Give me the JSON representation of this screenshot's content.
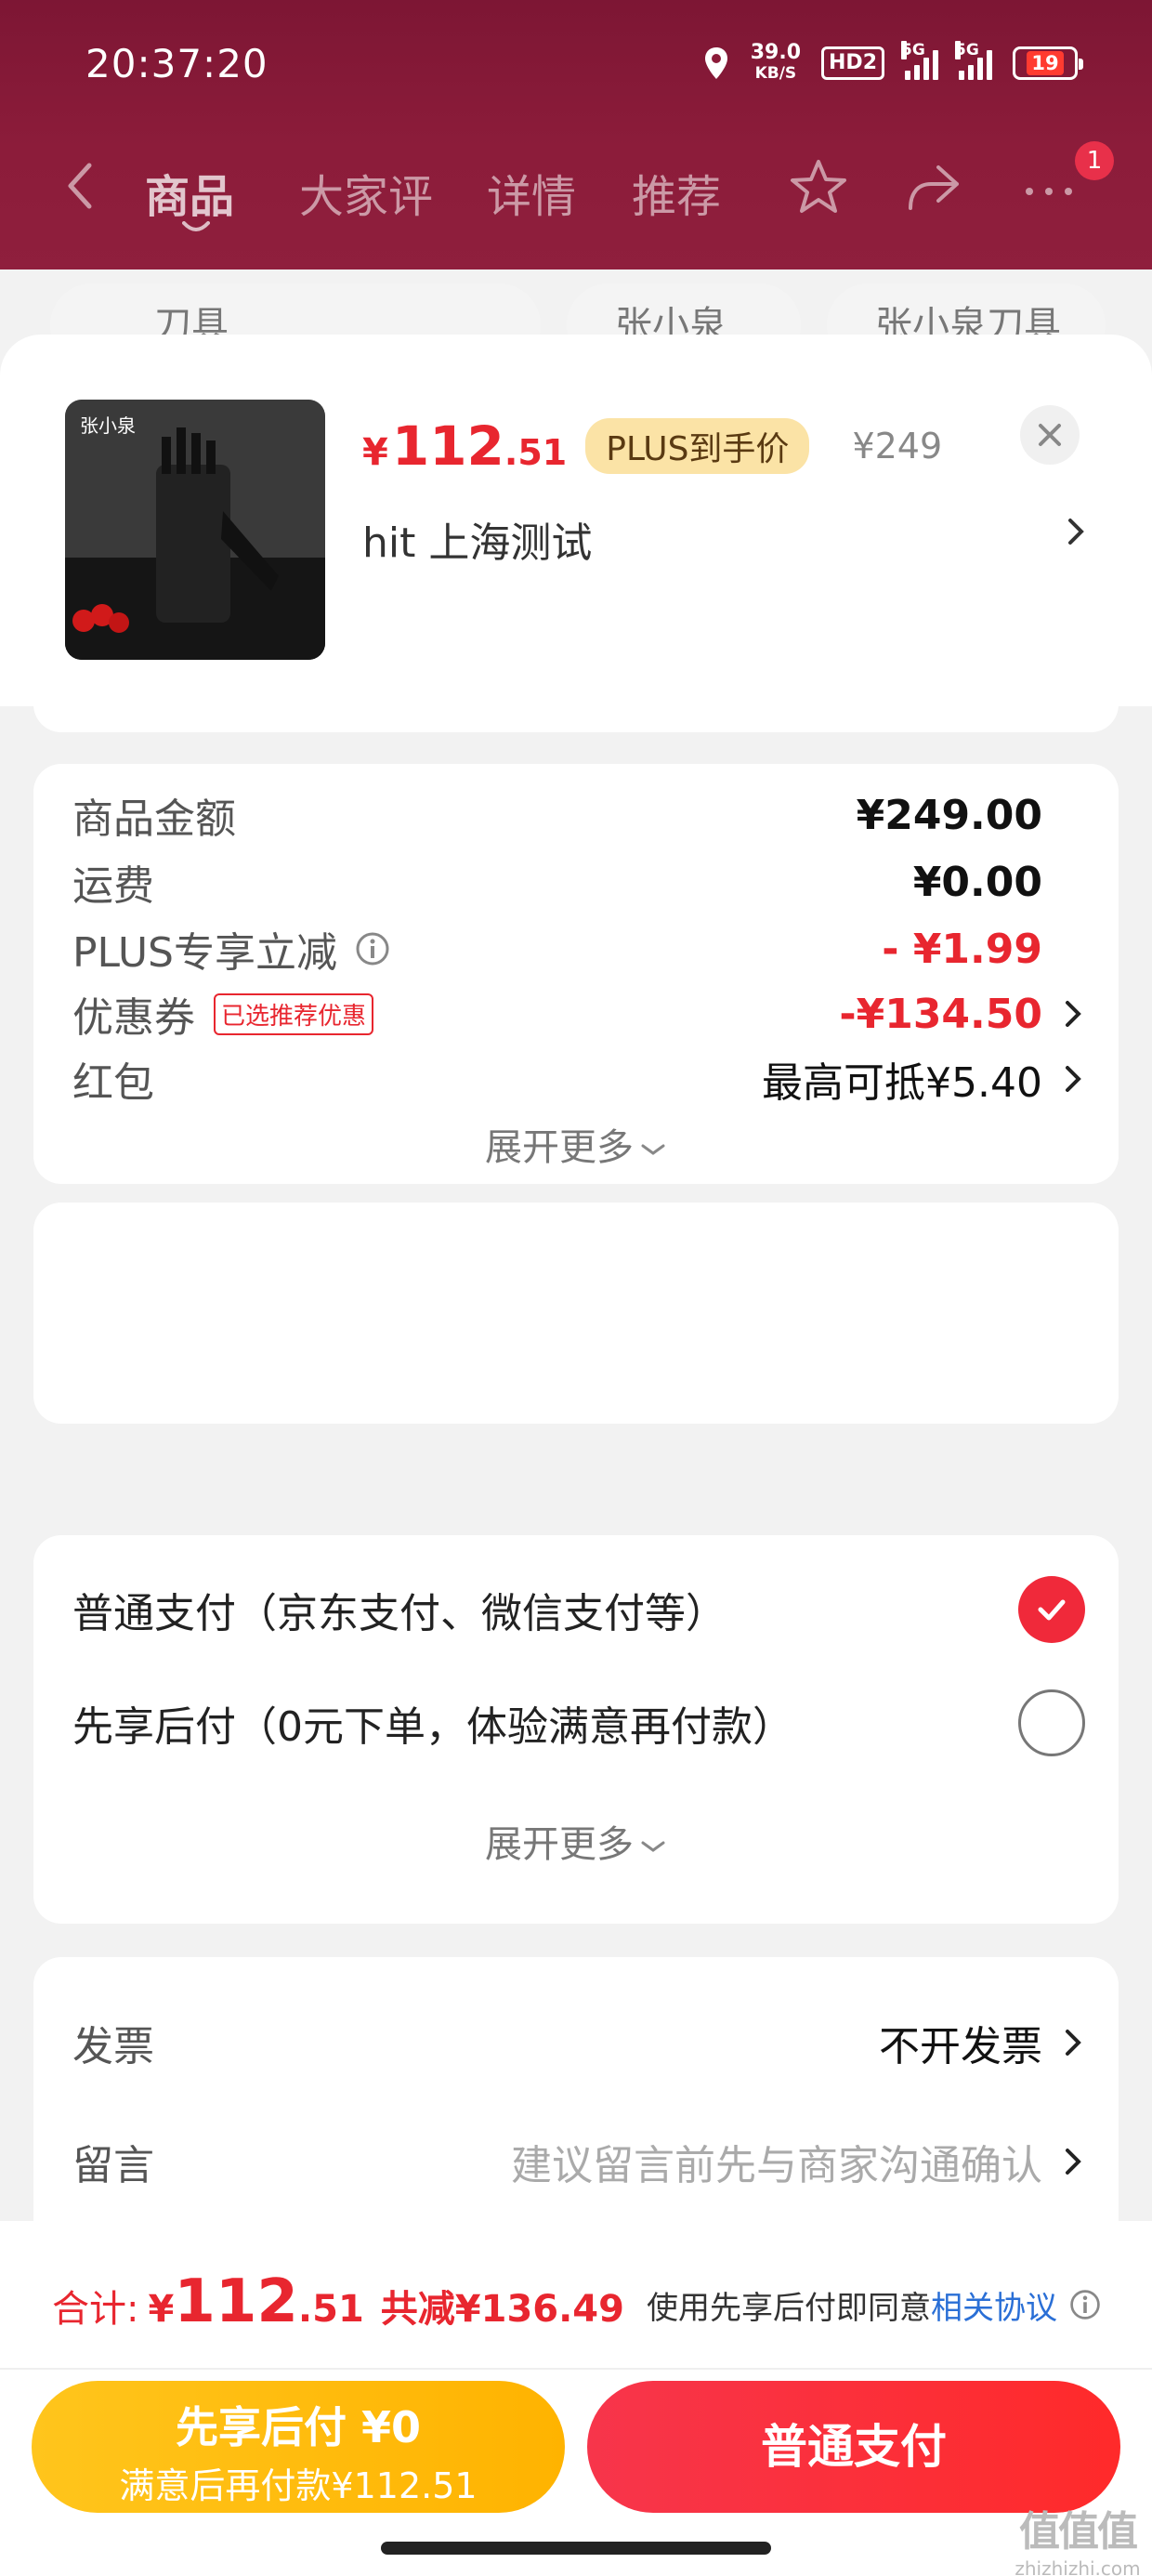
{
  "status_bar": {
    "time": "20:37:20",
    "speed_value": "39.0",
    "speed_unit": "KB/S",
    "hd": "HD2",
    "sig1": "5G",
    "sig2": "5G",
    "battery": "19"
  },
  "nav": {
    "tabs": [
      "商品",
      "大家评",
      "详情",
      "推荐"
    ],
    "notification_count": "1"
  },
  "search_row": {
    "query": "刀具",
    "chips": [
      "张小泉",
      "张小泉刀具"
    ]
  },
  "product": {
    "price_yen": "¥",
    "price_int": "112",
    "price_dec": ".51",
    "plus_tag": "PLUS到手价",
    "original_price": "¥249",
    "spec": "hit  上海测试",
    "brand_mark": "张小泉"
  },
  "cost_card": {
    "rows": [
      {
        "label": "商品金额",
        "value": "¥249.00"
      },
      {
        "label": "运费",
        "value": "¥0.00"
      },
      {
        "label": "PLUS专享立减",
        "value": "- ¥1.99"
      },
      {
        "label": "优惠券",
        "tag": "已选推荐优惠",
        "value": "-¥134.50"
      },
      {
        "label": "红包",
        "value": "最高可抵¥5.40"
      }
    ],
    "expand": "展开更多"
  },
  "payment_card": {
    "options": [
      {
        "label": "普通支付（京东支付、微信支付等）",
        "selected": true
      },
      {
        "label": "先享后付（0元下单，体验满意再付款）",
        "selected": false
      }
    ],
    "expand": "展开更多"
  },
  "extra_card": {
    "invoice_label": "发票",
    "invoice_value": "不开发票",
    "note_label": "留言",
    "note_placeholder": "建议留言前先与商家沟通确认"
  },
  "bottom": {
    "total_label": "合计:",
    "total_yen": "¥",
    "total_int": "112",
    "total_dec": ".51",
    "saved": "共减¥136.49",
    "agree_text": "使用先享后付即同意",
    "agree_link": "相关协议",
    "later_line1": "先享后付 ¥0",
    "later_line2": "满意后再付款¥112.51",
    "pay_label": "普通支付"
  },
  "watermark": {
    "line1": "值值值",
    "line2": "zhizhizhi.com"
  },
  "colors": {
    "accent_red": "#e8262f",
    "brand_maroon": "#8c1c3a",
    "gold": "#ffc51c",
    "link_blue": "#2a6fd6"
  }
}
